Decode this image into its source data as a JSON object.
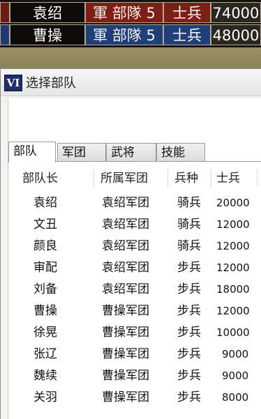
{
  "status": {
    "rows": [
      {
        "name": "袁绍",
        "army_label": "軍 部隊",
        "army_count": "5",
        "soldier_label": "士兵",
        "count": "74000"
      },
      {
        "name": "曹操",
        "army_label": "軍 部隊",
        "army_count": "5",
        "soldier_label": "士兵",
        "count": "48000"
      }
    ]
  },
  "dialog": {
    "icon_text": "VI",
    "title": "选择部队",
    "tabs": [
      "部队",
      "军团",
      "武将",
      "技能"
    ],
    "columns": [
      "部队长",
      "所属军团",
      "兵种",
      "士兵"
    ],
    "rows": [
      {
        "leader": "袁绍",
        "corps": "袁绍军团",
        "type": "骑兵",
        "soldiers": "20000"
      },
      {
        "leader": "文丑",
        "corps": "袁绍军团",
        "type": "骑兵",
        "soldiers": "12000"
      },
      {
        "leader": "颜良",
        "corps": "袁绍军团",
        "type": "骑兵",
        "soldiers": "12000"
      },
      {
        "leader": "审配",
        "corps": "袁绍军团",
        "type": "步兵",
        "soldiers": "12000"
      },
      {
        "leader": "刘备",
        "corps": "袁绍军团",
        "type": "步兵",
        "soldiers": "18000"
      },
      {
        "leader": "曹操",
        "corps": "曹操军团",
        "type": "步兵",
        "soldiers": "12000"
      },
      {
        "leader": "徐晃",
        "corps": "曹操军团",
        "type": "步兵",
        "soldiers": "10000"
      },
      {
        "leader": "张辽",
        "corps": "曹操军团",
        "type": "步兵",
        "soldiers": "9000"
      },
      {
        "leader": "魏续",
        "corps": "曹操军团",
        "type": "步兵",
        "soldiers": "9000"
      },
      {
        "leader": "关羽",
        "corps": "曹操军团",
        "type": "步兵",
        "soldiers": "8000"
      }
    ]
  }
}
